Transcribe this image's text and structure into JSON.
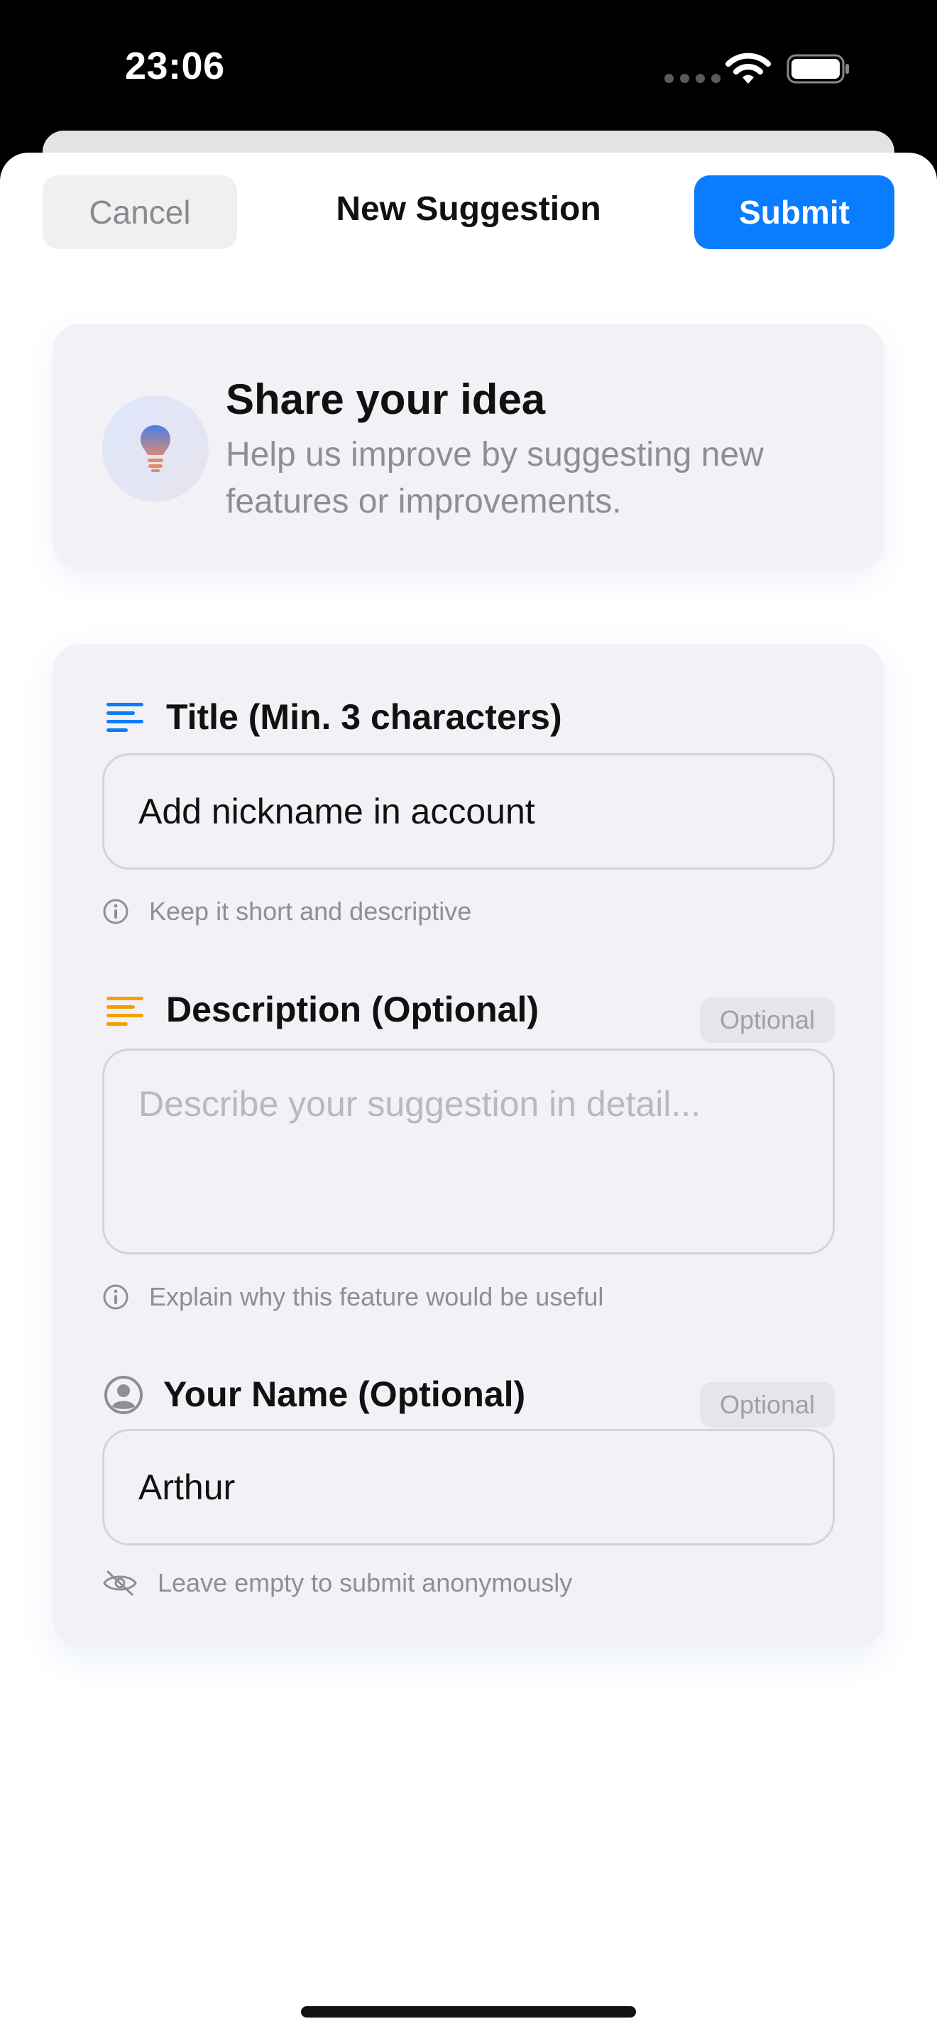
{
  "status_bar": {
    "time": "23:06",
    "icons": [
      "cellular-dots-icon",
      "wifi-icon",
      "battery-icon"
    ]
  },
  "nav": {
    "cancel_label": "Cancel",
    "title": "New Suggestion",
    "submit_label": "Submit"
  },
  "intro": {
    "icon": "lightbulb-icon",
    "title": "Share your idea",
    "subtitle": "Help us improve by suggesting new features or improvements."
  },
  "form": {
    "title_field": {
      "icon": "text-lines-icon",
      "label": "Title (Min. 3 characters)",
      "value": "Add nickname in account",
      "hint": "Keep it short and descriptive",
      "hint_icon": "info-icon"
    },
    "description_field": {
      "icon": "text-lines-icon",
      "label": "Description (Optional)",
      "badge": "Optional",
      "value": "",
      "placeholder": "Describe your suggestion in detail...",
      "hint": "Explain why this feature would be useful",
      "hint_icon": "info-icon"
    },
    "name_field": {
      "icon": "person-circle-icon",
      "label": "Your Name (Optional)",
      "badge": "Optional",
      "value": "Arthur",
      "hint": "Leave empty to submit anonymously",
      "hint_icon": "eye-slash-icon"
    }
  },
  "colors": {
    "accent": "#0a7cff",
    "title_icon": "#0a7cff",
    "description_icon": "#f5a000",
    "secondary_text": "#8e8e93",
    "card_background": "#f2f2f6"
  }
}
